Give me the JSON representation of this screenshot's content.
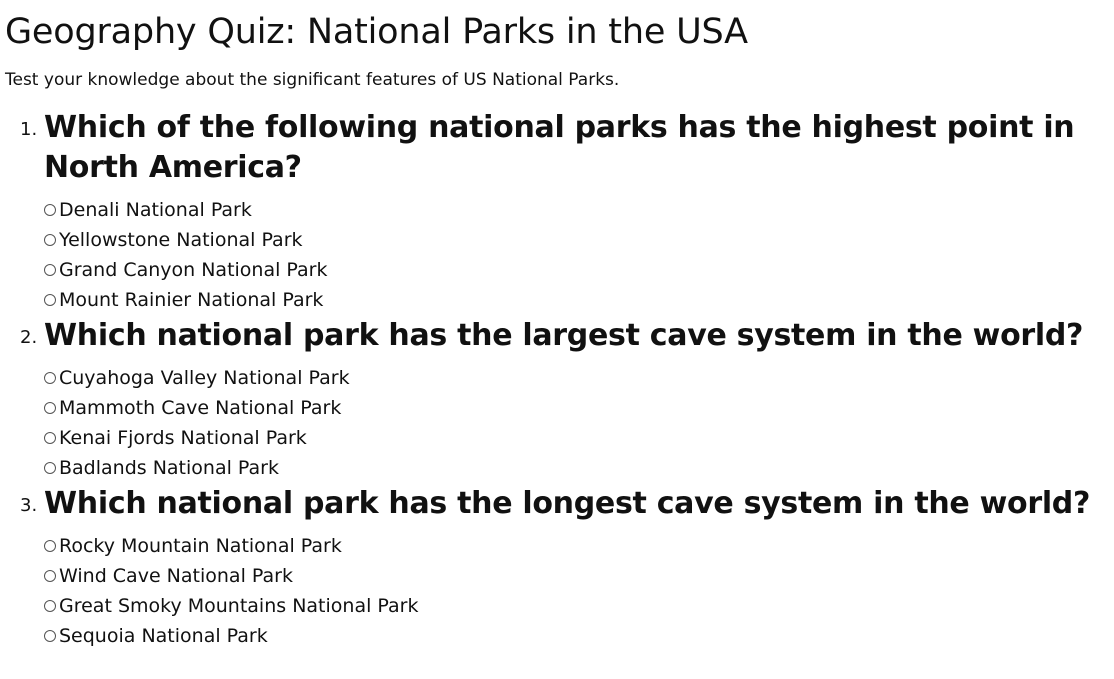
{
  "title": "Geography Quiz: National Parks in the USA",
  "subtitle": "Test your knowledge about the significant features of US National Parks.",
  "questions": [
    {
      "number": "1.",
      "text": "Which of the following national parks has the highest point in North America?",
      "options": [
        "Denali National Park",
        "Yellowstone National Park",
        "Grand Canyon National Park",
        "Mount Rainier National Park"
      ]
    },
    {
      "number": "2.",
      "text": "Which national park has the largest cave system in the world?",
      "options": [
        "Cuyahoga Valley National Park",
        "Mammoth Cave National Park",
        "Kenai Fjords National Park",
        "Badlands National Park"
      ]
    },
    {
      "number": "3.",
      "text": "Which national park has the longest cave system in the world?",
      "options": [
        "Rocky Mountain National Park",
        "Wind Cave National Park",
        "Great Smoky Mountains National Park",
        "Sequoia National Park"
      ]
    }
  ]
}
